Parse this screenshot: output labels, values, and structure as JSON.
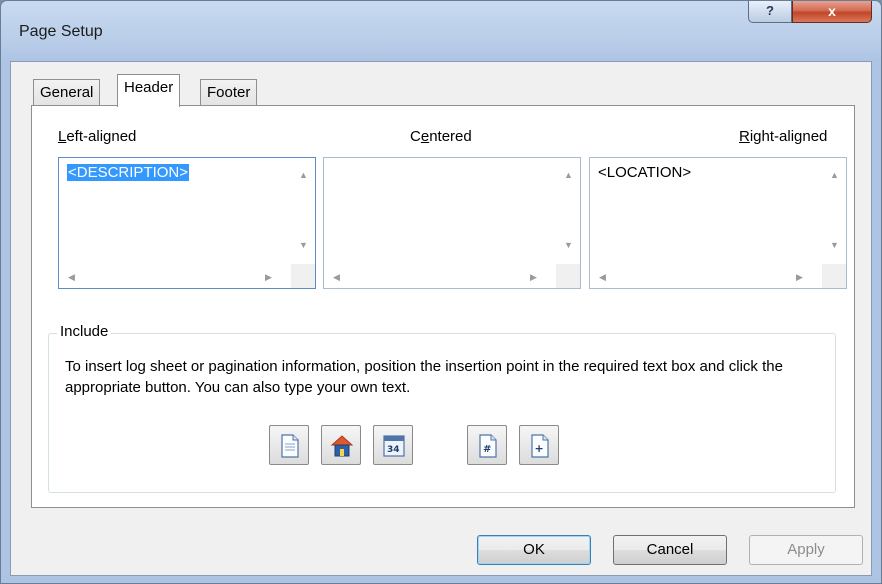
{
  "window": {
    "title": "Page Setup"
  },
  "titlebar": {
    "help_glyph": "?",
    "close_glyph": "x"
  },
  "tabs": [
    {
      "label": "General",
      "active": false
    },
    {
      "label": "Header",
      "active": true
    },
    {
      "label": "Footer",
      "active": false
    }
  ],
  "columns": {
    "left": {
      "label_first": "L",
      "label_rest": "eft-aligned",
      "value": "<DESCRIPTION>"
    },
    "center": {
      "label_pre": "C",
      "label_hot": "e",
      "label_post": "ntered",
      "value": ""
    },
    "right": {
      "label_first": "R",
      "label_rest": "ight-aligned",
      "value": "<LOCATION>"
    }
  },
  "include": {
    "legend": "Include",
    "description": "To insert log sheet or pagination information, position the insertion point in the required text box and click the appropriate button. You can also type your own text.",
    "buttons": [
      {
        "icon": "page-description-icon"
      },
      {
        "icon": "location-house-icon"
      },
      {
        "icon": "date-calendar-icon"
      },
      {
        "icon": "page-number-icon"
      },
      {
        "icon": "total-pages-icon"
      }
    ]
  },
  "footer_buttons": {
    "ok": "OK",
    "cancel": "Cancel",
    "apply": "Apply"
  },
  "colors": {
    "selection": "#3399ff",
    "house_roof": "#e2572b",
    "house_body": "#2c5fa8"
  }
}
